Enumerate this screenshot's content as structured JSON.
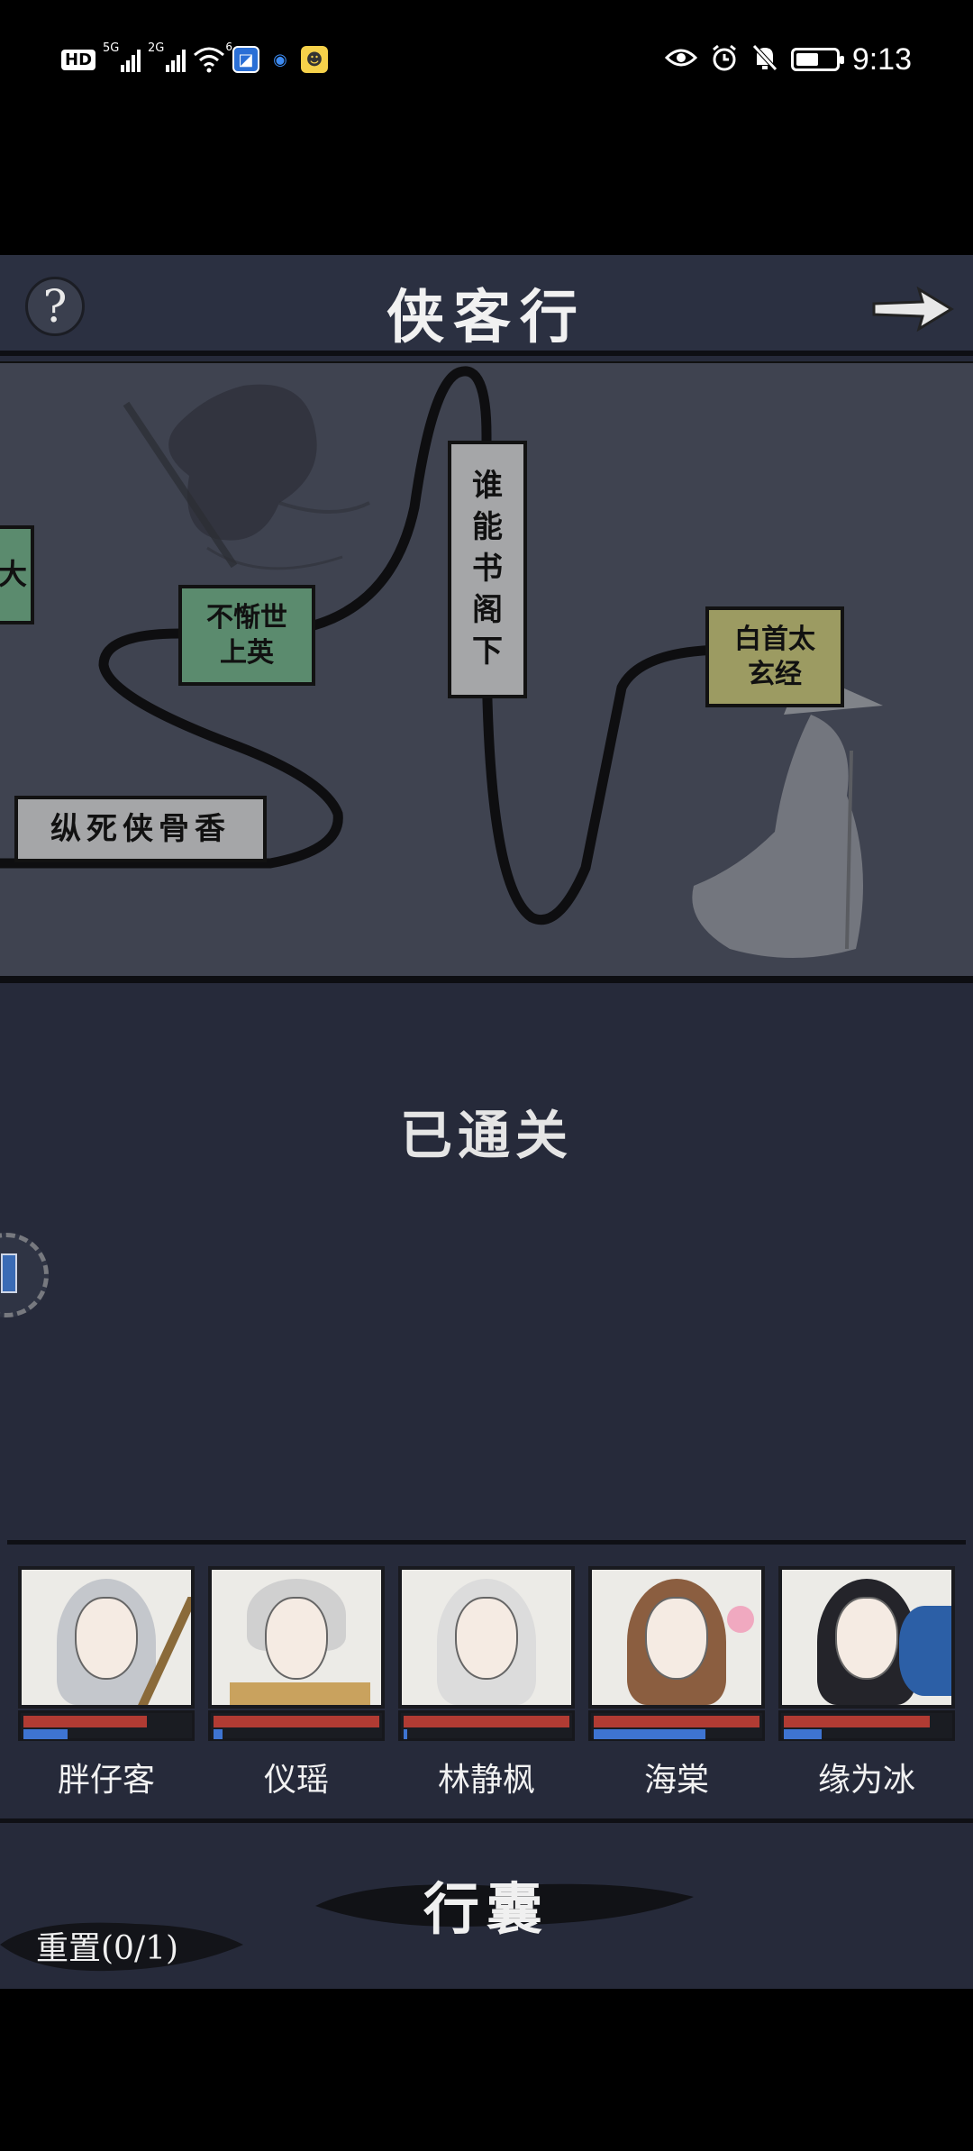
{
  "status_bar": {
    "network_badge": "HD",
    "sim1_tag": "5G",
    "sim2_tag": "2G",
    "wifi_tag": "6",
    "time": "9:13",
    "battery_level": 0.5,
    "icons": [
      "hd-icon",
      "signal-5g-icon",
      "signal-2g-icon",
      "wifi-icon",
      "app-icon-1",
      "app-icon-2",
      "app-icon-3",
      "eye-icon",
      "alarm-icon",
      "mute-bell-icon",
      "battery-icon"
    ]
  },
  "header": {
    "title": "侠客行",
    "help_label": "?"
  },
  "map": {
    "nodes": [
      {
        "id": "node-left-edge",
        "label": "大",
        "color": "#5b8b6e"
      },
      {
        "id": "node-1",
        "label": "不惭世上英",
        "line1": "不惭世",
        "line2": "上英",
        "color": "#5b8b6e"
      },
      {
        "id": "node-2",
        "label": "谁能书阁下",
        "color": "#a5a6a8",
        "vertical": [
          "谁",
          "能",
          "书",
          "阁",
          "下"
        ]
      },
      {
        "id": "node-3",
        "label": "白首太玄经",
        "line1": "白首太",
        "line2": "玄经",
        "color": "#9c9b62"
      },
      {
        "id": "node-4",
        "label": "纵死侠骨香",
        "color": "#a5a6a8"
      }
    ]
  },
  "status_text": "已通关",
  "party": [
    {
      "name": "胖仔客",
      "hp": 0.72,
      "mp": 0.26,
      "hair": "#c4c7cc"
    },
    {
      "name": "仪瑶",
      "hp": 1.0,
      "mp": 0.05,
      "hair": "#d0d0d0"
    },
    {
      "name": "林静枫",
      "hp": 1.0,
      "mp": 0.02,
      "hair": "#dcdcdc"
    },
    {
      "name": "海棠",
      "hp": 1.0,
      "mp": 0.65,
      "hair": "#8b5e40"
    },
    {
      "name": "缘为冰",
      "hp": 0.85,
      "mp": 0.22,
      "hair": "#24242a"
    }
  ],
  "bottom": {
    "bag_label": "行囊",
    "reset_label": "重置(0/1)"
  }
}
